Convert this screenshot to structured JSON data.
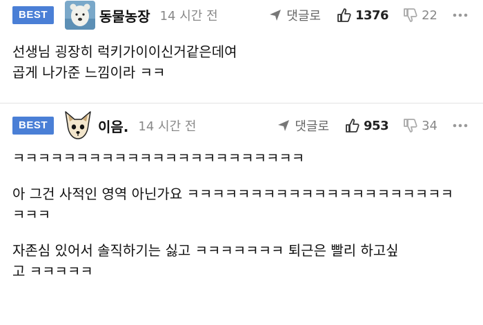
{
  "comments": [
    {
      "badge": "BEST",
      "avatar": "polar-bear-photo",
      "nickname": "동물농장",
      "time": "14 시간 전",
      "reply_label": "댓글로",
      "upvotes": "1376",
      "downvotes": "22",
      "lines": [
        "선생님 굉장히 럭키가이이신거같은데여",
        "곱게 나가준 느낌이라 ㅋㅋ"
      ]
    },
    {
      "badge": "BEST",
      "avatar": "chihuahua-drawing",
      "nickname": "이음.",
      "time": "14 시간 전",
      "reply_label": "댓글로",
      "upvotes": "953",
      "downvotes": "34",
      "paragraphs": [
        "ㅋㅋㅋㅋㅋㅋㅋㅋㅋㅋㅋㅋㅋㅋㅋㅋㅋㅋㅋㅋㅋㅋㅋ",
        "아 그건 사적인 영역 아닌가요 ㅋㅋㅋㅋㅋㅋㅋㅋㅋㅋㅋㅋㅋㅋㅋㅋㅋㅋㅋㅋㅋ\nㅋㅋㅋ",
        "자존심 있어서 솔직하기는 싫고 ㅋㅋㅋㅋㅋㅋㅋ 퇴근은 빨리 하고싶\n고 ㅋㅋㅋㅋㅋ"
      ]
    }
  ],
  "colors": {
    "best_badge": "#4a7fd6",
    "meta_gray": "#888888",
    "divider": "#e2e2e2"
  },
  "icons": [
    "reply-arrow-icon",
    "thumbs-up-icon",
    "thumbs-down-icon",
    "more-dots-icon"
  ]
}
